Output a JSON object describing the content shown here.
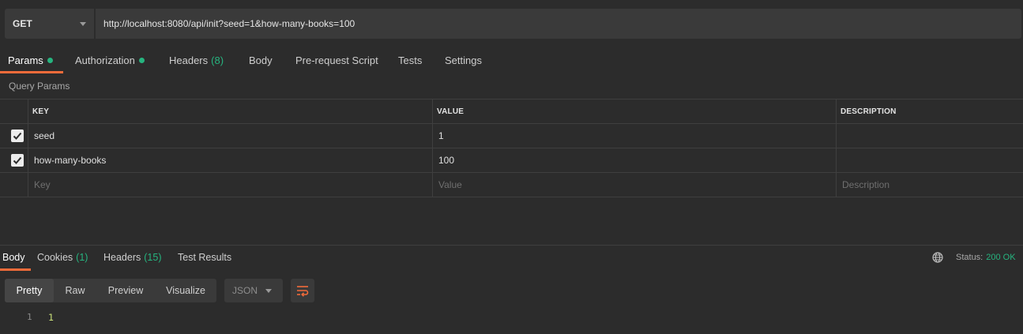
{
  "request": {
    "method": "GET",
    "url": "http://localhost:8080/api/init?seed=1&how-many-books=100"
  },
  "request_tabs": [
    {
      "label": "Params",
      "dot": true,
      "active": true
    },
    {
      "label": "Authorization",
      "dot": true
    },
    {
      "label": "Headers",
      "count": "(8)"
    },
    {
      "label": "Body"
    },
    {
      "label": "Pre-request Script"
    },
    {
      "label": "Tests"
    },
    {
      "label": "Settings"
    }
  ],
  "query_params": {
    "section_label": "Query Params",
    "columns": [
      "KEY",
      "VALUE",
      "DESCRIPTION"
    ],
    "rows": [
      {
        "checked": true,
        "key": "seed",
        "value": "1",
        "description": ""
      },
      {
        "checked": true,
        "key": "how-many-books",
        "value": "100",
        "description": ""
      }
    ],
    "placeholders": {
      "key": "Key",
      "value": "Value",
      "description": "Description"
    }
  },
  "response_tabs": [
    {
      "label": "Body",
      "active": true
    },
    {
      "label": "Cookies",
      "count": "(1)"
    },
    {
      "label": "Headers",
      "count": "(15)"
    },
    {
      "label": "Test Results"
    }
  ],
  "response_status": {
    "label": "Status:",
    "value": "200 OK"
  },
  "body_view": {
    "modes": [
      "Pretty",
      "Raw",
      "Preview",
      "Visualize"
    ],
    "active_mode": "Pretty",
    "format": "JSON"
  },
  "body_lines": [
    {
      "number": "1",
      "text": "1"
    }
  ],
  "colors": {
    "accent": "#f26b3a",
    "success": "#26b47f",
    "background": "#2c2c2c"
  },
  "icons": {
    "globe": "globe-icon",
    "wrap": "wrap-lines-icon",
    "check": "checkmark-icon",
    "dropdown": "chevron-down-icon"
  }
}
